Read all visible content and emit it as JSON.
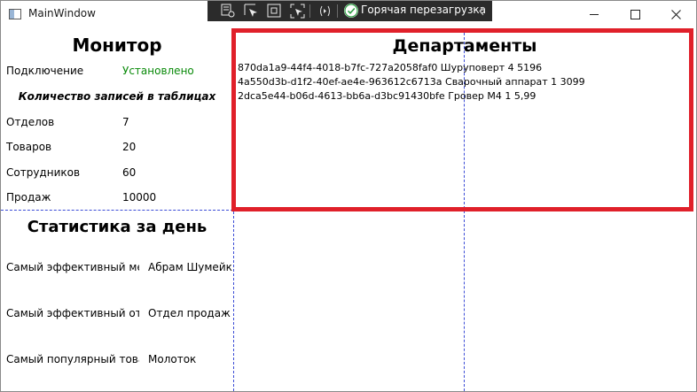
{
  "window": {
    "title": "MainWindow"
  },
  "debug_toolbar": {
    "hot_reload_label": "Горячая перезагрузка"
  },
  "monitor": {
    "title": "Монитор",
    "connection_label": "Подключение",
    "connection_value": "Установлено",
    "tables_heading": "Количество записей в таблицах",
    "rows": [
      {
        "label": "Отделов",
        "value": "7"
      },
      {
        "label": "Товаров",
        "value": "20"
      },
      {
        "label": "Сотрудников",
        "value": "60"
      },
      {
        "label": "Продаж",
        "value": "10000"
      }
    ],
    "colors": {
      "connected": "#0a8a0a"
    }
  },
  "stats": {
    "title": "Статистика за день",
    "rows": [
      {
        "label": "Самый эффективный менеджер:",
        "value": "Абрам Шумейко"
      },
      {
        "label": "Самый эффективный отдел:",
        "value": "Отдел продаж"
      },
      {
        "label": "Самый популярный товар:",
        "value": "Молоток"
      }
    ]
  },
  "departments": {
    "title": "Департаменты",
    "items": [
      "870da1a9-44f4-4018-b7fc-727a2058faf0 Шуруповерт 4 5196",
      "4a550d3b-d1f2-40ef-ae4e-963612c6713a Сварочный аппарат 1 3099",
      "2dca5e44-b06d-4613-bb6a-d3bc91430bfe Гровер М4 1 5,99"
    ],
    "highlight_color": "#e0202a"
  },
  "icons": {
    "app": "app-window-icon",
    "toolbar": [
      "live-visual-tree-icon",
      "select-element-icon",
      "display-layout-adorners-icon",
      "track-focus-icon",
      "xaml-binding-failures-icon",
      "hot-reload-status-icon",
      "collapse-toolbar-icon"
    ]
  }
}
